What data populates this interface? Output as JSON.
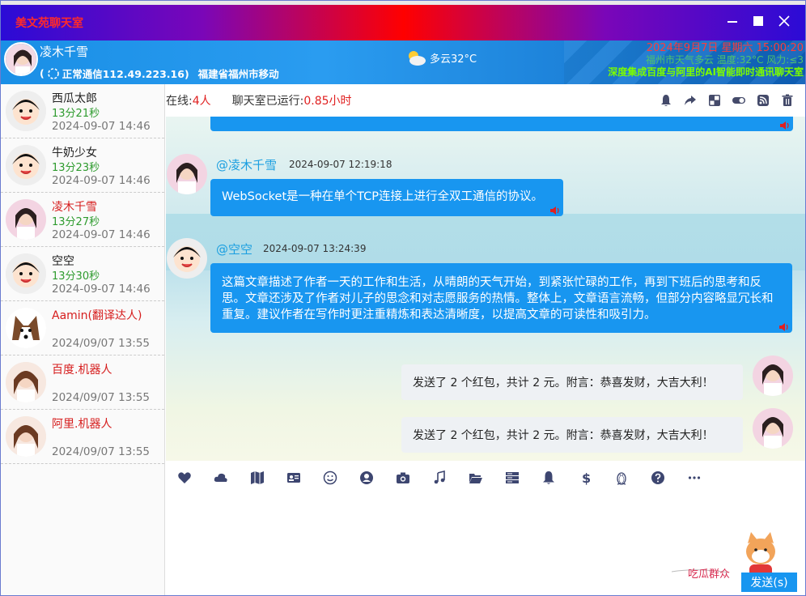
{
  "window": {
    "title": "美文苑聊天室"
  },
  "profile": {
    "name": "凌木千雪",
    "status": "正常通信112.49.223.16)",
    "location": "福建省福州市移动",
    "weather": "多云32°C"
  },
  "header_right": {
    "date": "2024年9月7日    星期六 15:00:20",
    "weather_line": "福州市天气多云 温度:32°C 风力:≤3",
    "slogan": "深度集成百度与阿里的AI智能即时通讯聊天室"
  },
  "room": {
    "online_label": "在线:",
    "online_count": "4人",
    "runtime_label": "聊天室已运行:",
    "runtime_value": "0.85小时"
  },
  "users": [
    {
      "name": "西瓜太郎",
      "duration": "13分21秒",
      "time": "2024-09-07 14:46",
      "highlight": false
    },
    {
      "name": "牛奶少女",
      "duration": "13分23秒",
      "time": "2024-09-07 14:46",
      "highlight": false
    },
    {
      "name": "凌木千雪",
      "duration": "13分27秒",
      "time": "2024-09-07 14:46",
      "highlight": true
    },
    {
      "name": "空空",
      "duration": "13分30秒",
      "time": "2024-09-07 14:46",
      "highlight": false
    },
    {
      "name": "Aamin(翻译达人)",
      "duration": "",
      "time": "2024/09/07 13:55",
      "highlight": true
    },
    {
      "name": "百度.机器人",
      "duration": "",
      "time": "2024/09/07 13:55",
      "highlight": true
    },
    {
      "name": "阿里.机器人",
      "duration": "",
      "time": "2024/09/07 13:55",
      "highlight": true
    }
  ],
  "messages": [
    {
      "sender": "@凌木千雪",
      "time": "2024-09-07 12:19:18",
      "text": "WebSocket是一种在单个TCP连接上进行全双工通信的协议。"
    },
    {
      "sender": "@空空",
      "time": "2024-09-07 13:24:39",
      "text": "这篇文章描述了作者一天的工作和生活，从晴朗的天气开始，到紧张忙碌的工作，再到下班后的思考和反思。文章还涉及了作者对儿子的思念和对志愿服务的热情。整体上，文章语言流畅，但部分内容略显冗长和重复。建议作者在写作时更注重精炼和表达清晰度，以提高文章的可读性和吸引力。"
    }
  ],
  "own_messages": [
    {
      "text": "发送了 2 个红包，共计 2 元。附言：恭喜发财，大吉大利！"
    },
    {
      "text": "发送了 2 个红包，共计 2 元。附言：恭喜发财，大吉大利！"
    }
  ],
  "send_button": "发送(s)",
  "mascot_text": "吃瓜群众",
  "colors": {
    "accent": "#1896f0",
    "highlight": "#d61d1d",
    "duration": "#2e9b2e"
  }
}
